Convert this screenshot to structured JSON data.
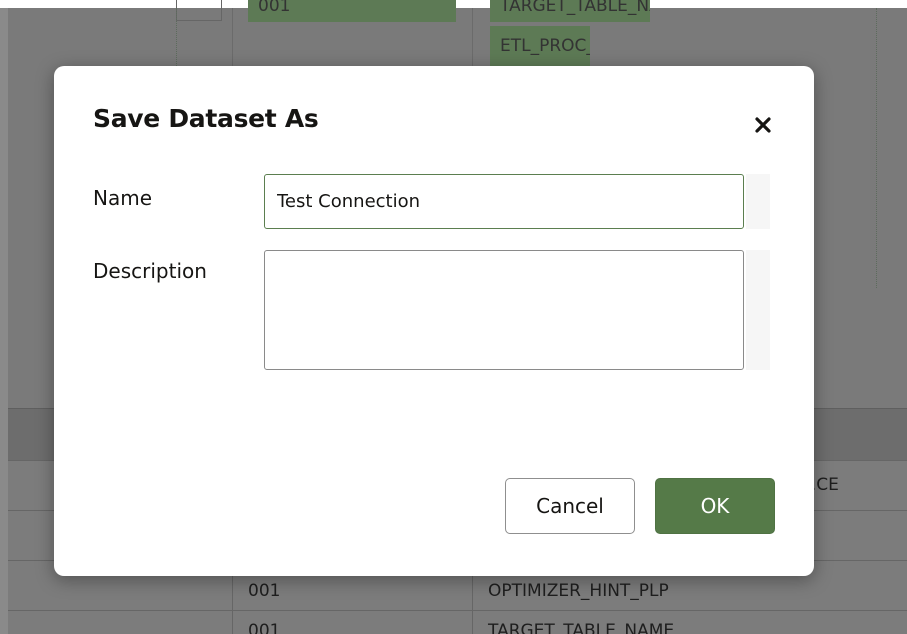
{
  "background": {
    "top_cells": [
      "001",
      "TARGET_TABLE_NAME",
      "ETL_PROC_WID"
    ],
    "table_rows": [
      [
        "",
        "",
        "...CE"
      ],
      [
        "",
        "",
        ""
      ],
      [
        "",
        "001",
        "OPTIMIZER_HINT_PLP"
      ],
      [
        "",
        "001",
        "TARGET_TABLE_NAME"
      ]
    ]
  },
  "dialog": {
    "title": "Save Dataset As",
    "close_icon": "close-icon",
    "name_label": "Name",
    "name_value": "Test Connection",
    "name_placeholder": "",
    "description_label": "Description",
    "description_value": "",
    "cancel_label": "Cancel",
    "ok_label": "OK"
  },
  "colors": {
    "accent": "#557a48",
    "input_focus_border": "#5b7e4f",
    "overlay": "#7a7a7a"
  }
}
